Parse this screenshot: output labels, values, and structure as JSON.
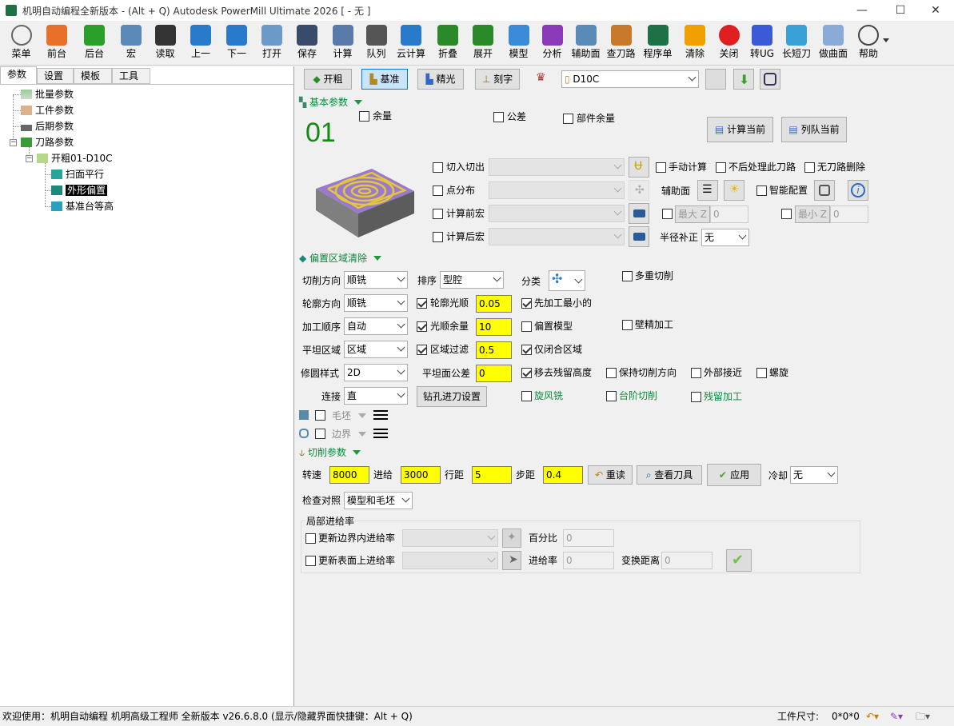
{
  "window": {
    "title": "机明自动编程全新版本 - (Alt + Q) Autodesk PowerMill Ultimate 2026    [  - 无 ]"
  },
  "toolbar": [
    {
      "label": "菜单",
      "icon": "gear-icon"
    },
    {
      "label": "前台",
      "icon": "powermill-icon"
    },
    {
      "label": "后台",
      "icon": "plus-icon"
    },
    {
      "label": "宏",
      "icon": "macro-icon"
    },
    {
      "label": "读取",
      "icon": "sliders-icon"
    },
    {
      "label": "上一",
      "icon": "prev-icon"
    },
    {
      "label": "下一",
      "icon": "next-icon"
    },
    {
      "label": "打开",
      "icon": "folder-open-icon"
    },
    {
      "label": "保存",
      "icon": "save-icon"
    },
    {
      "label": "计算",
      "icon": "calculator-icon"
    },
    {
      "label": "队列",
      "icon": "queue-icon"
    },
    {
      "label": "云计算",
      "icon": "cloud-icon"
    },
    {
      "label": "折叠",
      "icon": "collapse-icon"
    },
    {
      "label": "展开",
      "icon": "expand-icon"
    },
    {
      "label": "模型",
      "icon": "cube-icon"
    },
    {
      "label": "分析",
      "icon": "analysis-icon"
    },
    {
      "label": "辅助面",
      "icon": "aux-surface-icon"
    },
    {
      "label": "查刀路",
      "icon": "tools-icon"
    },
    {
      "label": "程序单",
      "icon": "excel-icon"
    },
    {
      "label": "清除",
      "icon": "warning-icon"
    },
    {
      "label": "关闭",
      "icon": "close-circle-icon"
    },
    {
      "label": "转UG",
      "icon": "ug-icon"
    },
    {
      "label": "长短刀",
      "icon": "long-short-tool-icon"
    },
    {
      "label": "做曲面",
      "icon": "surface-icon"
    },
    {
      "label": "帮助",
      "icon": "help-icon"
    }
  ],
  "left": {
    "tabs": [
      "参数",
      "设置",
      "模板",
      "工具"
    ],
    "tree": [
      {
        "label": "批量参数"
      },
      {
        "label": "工件参数"
      },
      {
        "label": "后期参数"
      },
      {
        "label": "刀路参数"
      },
      {
        "label": "开粗01-D10C"
      },
      {
        "label": "扫面平行"
      },
      {
        "label": "外形偏置"
      },
      {
        "label": "基准台等高"
      }
    ]
  },
  "right": {
    "top_buttons": [
      "开粗",
      "基准",
      "精光",
      "刻字"
    ],
    "tool_select": "D10C",
    "basic": {
      "title": "基本参数",
      "number": "01",
      "cb_allowance": "余量",
      "cb_tolerance": "公差",
      "cb_part_allowance": "部件余量",
      "btn_calc_current": "计算当前",
      "btn_queue_current": "列队当前",
      "cb_leadin": "切入切出",
      "cb_point_dist": "点分布",
      "cb_pre_macro": "计算前宏",
      "cb_post_macro": "计算后宏",
      "cb_manual": "手动计算",
      "cb_no_process": "不后处理此刀路",
      "cb_no_delete": "无刀路删除",
      "aux_label": "辅助面",
      "cb_smart": "智能配置",
      "max_z_label": "最大 Z",
      "max_z": "0",
      "min_z_label": "最小 Z",
      "min_z": "0",
      "radius_comp_label": "半径补正",
      "radius_comp": "无"
    },
    "offset": {
      "title": "偏置区域清除",
      "cut_dir_label": "切削方向",
      "cut_dir": "顺铣",
      "sort_label": "排序",
      "sort": "型腔",
      "class_label": "分类",
      "cb_multi": "多重切削",
      "contour_dir_label": "轮廓方向",
      "contour_dir": "顺铣",
      "cb_contour_smooth": "轮廓光顺",
      "contour_smooth": "0.05",
      "cb_smallest_first": "先加工最小的",
      "order_label": "加工顺序",
      "order": "自动",
      "cb_smooth_allow": "光顺余量",
      "smooth_allow": "10",
      "cb_offset_model": "偏置模型",
      "cb_wall_finish": "壁精加工",
      "flat_label": "平坦区域",
      "flat": "区域",
      "cb_region_filter": "区域过滤",
      "region_filter": "0.5",
      "cb_closed_only": "仅闭合区域",
      "fillet_label": "修圆样式",
      "fillet": "2D",
      "flat_tol_label": "平坦面公差",
      "flat_tol": "0",
      "cb_remove_rest": "移去残留高度",
      "cb_keep_dir": "保持切削方向",
      "cb_outside": "外部接近",
      "cb_spiral": "螺旋",
      "link_label": "连接",
      "link": "直",
      "btn_drill": "钻孔进刀设置",
      "cb_vortex": "旋风铣",
      "cb_step_cut": "台阶切削",
      "cb_rest": "残留加工",
      "blank_label": "毛坯",
      "boundary_label": "边界"
    },
    "cutting": {
      "title": "切削参数",
      "speed_label": "转速",
      "speed": "8000",
      "feed_label": "进给",
      "feed": "3000",
      "stepover_label": "行距",
      "stepover": "5",
      "stepdown_label": "步距",
      "stepdown": "0.4",
      "btn_reread": "重读",
      "btn_view_tool": "查看刀具",
      "btn_apply": "应用",
      "coolant_label": "冷却",
      "coolant": "无",
      "check_label": "检查对照",
      "check": "模型和毛坯"
    },
    "local_feed": {
      "title": "局部进给率",
      "cb_boundary": "更新边界内进给率",
      "percent_label": "百分比",
      "percent": "0",
      "cb_surface": "更新表面上进给率",
      "feed_label": "进给率",
      "feed": "0",
      "trans_label": "变换距离",
      "trans": "0"
    }
  },
  "status": {
    "text": "欢迎使用：机明自动编程 机明高级工程师 全新版本 v26.6.8.0  (显示/隐藏界面快捷键：Alt + Q)",
    "size_label": "工件尺寸:",
    "size": "0*0*0"
  }
}
